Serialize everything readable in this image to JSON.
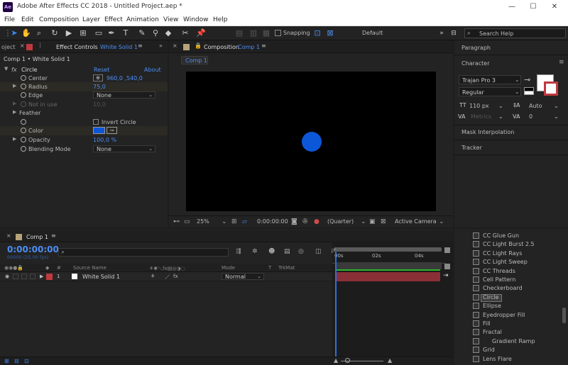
{
  "window": {
    "logo": "Ae",
    "title": "Adobe After Effects CC 2018 - Untitled Project.aep *",
    "minimize": "—",
    "maximize": "☐",
    "close": "✕"
  },
  "menu": [
    "File",
    "Edit",
    "Composition",
    "Layer",
    "Effect",
    "Animation",
    "View",
    "Window",
    "Help"
  ],
  "toolbar": {
    "snapping_label": "Snapping",
    "workspace": "Default",
    "search_placeholder": "Search Help"
  },
  "effect_controls": {
    "tab_left": "oject",
    "tab_label": "Effect Controls",
    "tab_layer": "White Solid 1",
    "layer_path": "Comp 1 • White Solid 1",
    "effect_name": "Circle",
    "reset": "Reset",
    "about": "About",
    "props": {
      "center": "Center",
      "center_value": "960,0 ,540,0",
      "radius": "Radius",
      "radius_value": "75,0",
      "edge": "Edge",
      "edge_value": "None",
      "not_in_use": "Not in use",
      "not_in_use_value": "10,0",
      "feather": "Feather",
      "invert_circle": "Invert Circle",
      "color": "Color",
      "opacity": "Opacity",
      "opacity_value": "100,0 %",
      "blending_mode": "Blending Mode",
      "blending_value": "None"
    },
    "circle_color": "#0c57d8"
  },
  "composition": {
    "tab_label": "Composition",
    "tab_comp": "Comp 1",
    "breadcrumb": "Comp 1",
    "zoom": "25%",
    "timecode": "0:00:00:00",
    "resolution": "(Quarter)",
    "camera": "Active Camera"
  },
  "right_panels": {
    "paragraph": "Paragraph",
    "character": "Character",
    "font": "Trajan Pro 3",
    "style": "Regular",
    "font_size": "110 px",
    "leading": "Auto",
    "kerning": "Metrics",
    "tracking": "0",
    "mask_interpolation": "Mask Interpolation",
    "tracker": "Tracker"
  },
  "timeline": {
    "tab_label": "Comp 1",
    "current_time": "0:00:00:00",
    "fps": "00000 (25.00 fps)",
    "columns": {
      "source_name": "Source Name",
      "mode": "Mode",
      "t": "T",
      "trkmat": "TrkMat"
    },
    "ruler": [
      "00s",
      "02s",
      "04s"
    ],
    "layer": {
      "number": "1",
      "name": "White Solid 1",
      "mode": "Normal"
    },
    "layer_color": "#c0393f"
  },
  "effects_list": {
    "items": [
      "CC Glue Gun",
      "CC Light Burst 2.5",
      "CC Light Rays",
      "CC Light Sweep",
      "CC Threads",
      "Cell Pattern",
      "Checkerboard",
      "Circle",
      "Ellipse",
      "Eyedropper Fill",
      "Fill",
      "Fractal",
      "Gradient Ramp",
      "Grid",
      "Lens Flare"
    ],
    "selected": "Circle"
  }
}
